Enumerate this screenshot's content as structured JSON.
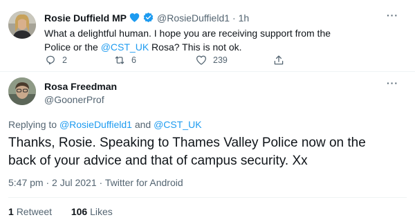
{
  "reply_tweet": {
    "display_name": "Rosie Duffield MP",
    "handle": "@RosieDuffield1",
    "time": "· 1h",
    "text_before_link": "What a delightful human. I hope you are receiving support from the Police or the ",
    "link_text": "@CST_UK",
    "text_after_link": " Rosa? This is not ok.",
    "reply_count": "2",
    "retweet_count": "6",
    "like_count": "239"
  },
  "main_tweet": {
    "display_name": "Rosa Freedman",
    "handle": "@GoonerProf",
    "replying_prefix": "Replying to ",
    "replying_user1": "@RosieDuffield1",
    "replying_and": " and ",
    "replying_user2": "@CST_UK",
    "text": "Thanks, Rosie. Speaking to Thames Valley Police now on the back of your advice and that of campus security. Xx",
    "meta": "5:47 pm · 2 Jul 2021 · Twitter for Android"
  },
  "stats": {
    "retweets_count": "1",
    "retweets_label": "Retweet",
    "likes_count": "106",
    "likes_label": "Likes"
  },
  "icons": {
    "more": "more-icon",
    "heart_badge": "blue-heart-icon",
    "verified": "verified-icon",
    "reply": "reply-icon",
    "retweet": "retweet-icon",
    "like": "like-icon",
    "share": "share-icon"
  },
  "colors": {
    "link": "#1d9bf0",
    "secondary_text": "#536471",
    "primary_text": "#0f1419",
    "divider": "#eff3f4"
  }
}
